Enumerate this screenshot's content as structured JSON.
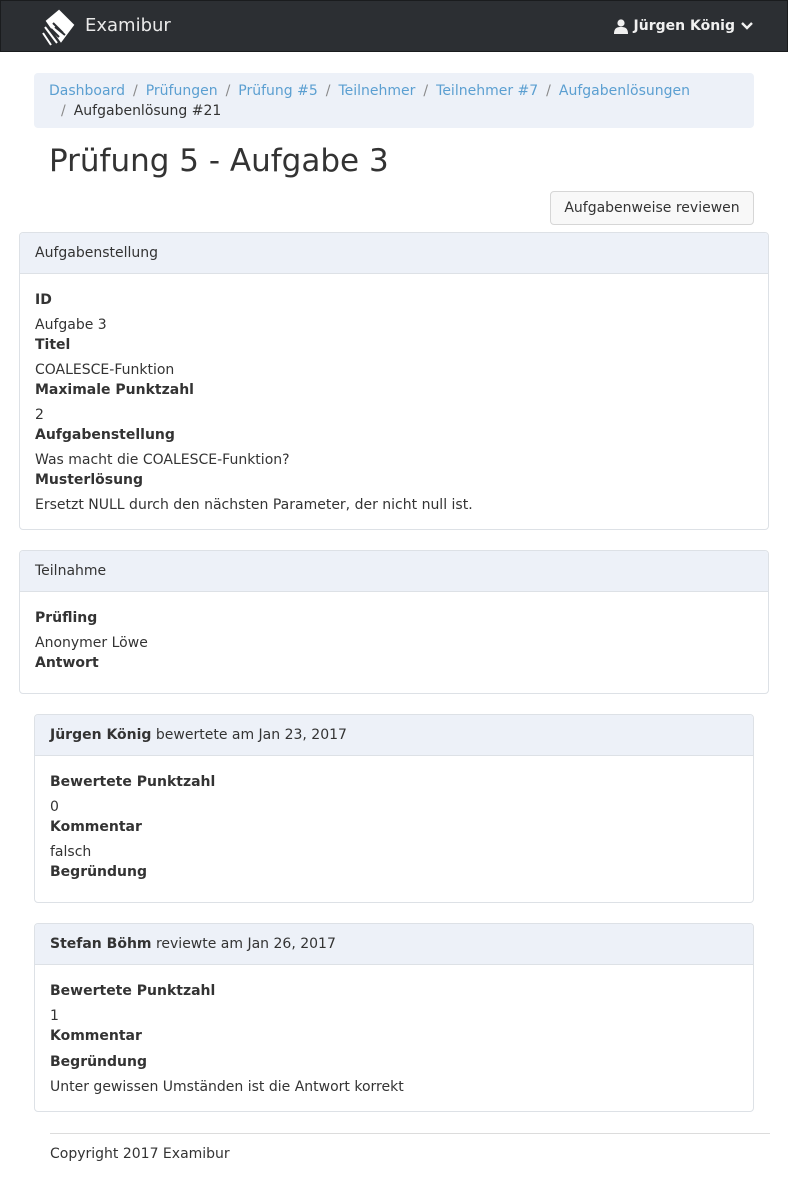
{
  "app": {
    "name": "Examibur",
    "user_name": "Jürgen König"
  },
  "breadcrumb": [
    "Dashboard",
    "Prüfungen",
    "Prüfung #5",
    "Teilnehmer",
    "Teilnehmer #7",
    "Aufgabenlösungen",
    "Aufgabenlösung #21"
  ],
  "page": {
    "title": "Prüfung 5 - Aufgabe 3",
    "review_button": "Aufgabenweise reviewen"
  },
  "task_panel": {
    "heading": "Aufgabenstellung",
    "id_label": "ID",
    "id_value": "Aufgabe 3",
    "title_label": "Titel",
    "title_value": "COALESCE-Funktion",
    "max_label": "Maximale Punktzahl",
    "max_value": "2",
    "question_label": "Aufgabenstellung",
    "question_value": "Was macht die COALESCE-Funktion?",
    "solution_label": "Musterlösung",
    "solution_value": "Ersetzt NULL durch den nächsten Parameter, der nicht null ist."
  },
  "participation_panel": {
    "heading": "Teilnahme",
    "candidate_label": "Prüfling",
    "candidate_value": "Anonymer Löwe",
    "answer_label": "Antwort"
  },
  "evaluations": [
    {
      "author": "Jürgen König",
      "action": "bewertete am Jan 23, 2017",
      "points_label": "Bewertete Punktzahl",
      "points_value": "0",
      "comment_label": "Kommentar",
      "comment_value": "falsch",
      "reason_label": "Begründung",
      "reason_value": ""
    },
    {
      "author": "Stefan Böhm",
      "action": "reviewte am Jan 26, 2017",
      "points_label": "Bewertete Punktzahl",
      "points_value": "1",
      "comment_label": "Kommentar",
      "comment_value": "",
      "reason_label": "Begründung",
      "reason_value": "Unter gewissen Umständen ist die Antwort korrekt"
    }
  ],
  "footer": {
    "text": "Copyright 2017 Examibur"
  },
  "icons": {
    "logo": "scroll-logo-icon",
    "user": "user-icon",
    "caret": "chevron-down-icon"
  },
  "colors": {
    "navbar": "#2c2f33",
    "link": "#5b9fd1",
    "panel_heading": "#edf1f8"
  }
}
